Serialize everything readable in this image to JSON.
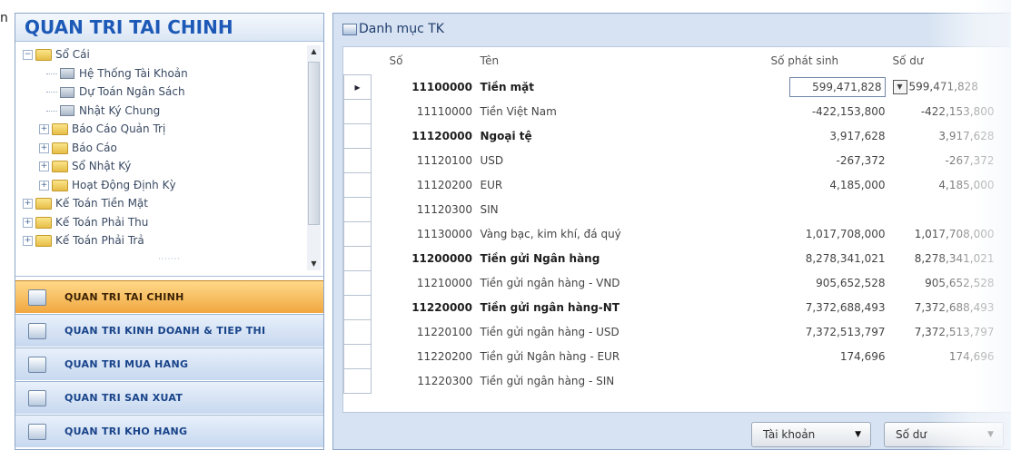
{
  "stray_text": "n",
  "left_panel": {
    "title": "QUAN TRI TAI CHINH",
    "tree": [
      {
        "label": "Sổ Cái",
        "type": "folder",
        "expand": "−"
      },
      {
        "label": "Hệ Thống Tài Khoản",
        "type": "doc"
      },
      {
        "label": "Dự Toán Ngân Sách",
        "type": "doc"
      },
      {
        "label": "Nhật Ký Chung",
        "type": "doc"
      },
      {
        "label": "Báo Cáo Quản Trị",
        "type": "folder",
        "expand": "+"
      },
      {
        "label": "Báo Cáo",
        "type": "folder",
        "expand": "+"
      },
      {
        "label": "Sổ Nhật Ký",
        "type": "folder",
        "expand": "+"
      },
      {
        "label": "Hoạt Động Định Kỳ",
        "type": "folder",
        "expand": "+"
      },
      {
        "label": "Kế Toán Tiền Mặt",
        "type": "folder",
        "expand": "+"
      },
      {
        "label": "Kế Toán Phải Thu",
        "type": "folder",
        "expand": "+"
      },
      {
        "label": "Kế Toán Phải Trả",
        "type": "folder",
        "expand": "+"
      }
    ],
    "grip": "·······",
    "nav": [
      {
        "label": "QUAN TRI TAI CHINH",
        "active": true
      },
      {
        "label": "QUAN TRI KINH DOANH & TIEP THI",
        "active": false
      },
      {
        "label": "QUAN TRI MUA HANG",
        "active": false
      },
      {
        "label": "QUAN TRI SAN XUAT",
        "active": false
      },
      {
        "label": "QUAN TRI KHO HANG",
        "active": false
      }
    ]
  },
  "right_panel": {
    "title": "Danh mục TK",
    "columns": [
      "Số",
      "Tên",
      "Số phát sinh",
      "Số dư"
    ],
    "rows": [
      {
        "code": "11100000",
        "name": "Tiền mặt",
        "phat_sinh": "599,471,828",
        "so_du": "599,471,828",
        "bold": true,
        "selected": true
      },
      {
        "code": "11110000",
        "name": "Tiền Việt Nam",
        "phat_sinh": "-422,153,800",
        "so_du": "-422,153,800",
        "bold": false
      },
      {
        "code": "11120000",
        "name": "Ngoại tệ",
        "phat_sinh": "3,917,628",
        "so_du": "3,917,628",
        "bold": true
      },
      {
        "code": "11120100",
        "name": "USD",
        "phat_sinh": "-267,372",
        "so_du": "-267,372",
        "bold": false
      },
      {
        "code": "11120200",
        "name": "EUR",
        "phat_sinh": "4,185,000",
        "so_du": "4,185,000",
        "bold": false
      },
      {
        "code": "11120300",
        "name": "SIN",
        "phat_sinh": "",
        "so_du": "",
        "bold": false
      },
      {
        "code": "11130000",
        "name": "Vàng bạc, kim khí, đá quý",
        "phat_sinh": "1,017,708,000",
        "so_du": "1,017,708,000",
        "bold": false
      },
      {
        "code": "11200000",
        "name": "Tiền gửi Ngân hàng",
        "phat_sinh": "8,278,341,021",
        "so_du": "8,278,341,021",
        "bold": true
      },
      {
        "code": "11210000",
        "name": "Tiền gửi ngân hàng - VND",
        "phat_sinh": "905,652,528",
        "so_du": "905,652,528",
        "bold": false
      },
      {
        "code": "11220000",
        "name": "Tiền gửi ngân hàng-NT",
        "phat_sinh": "7,372,688,493",
        "so_du": "7,372,688,493",
        "bold": true
      },
      {
        "code": "11220100",
        "name": "Tiền gửi ngân hàng - USD",
        "phat_sinh": "7,372,513,797",
        "so_du": "7,372,513,797",
        "bold": false
      },
      {
        "code": "11220200",
        "name": "Tiền gửi Ngân hàng - EUR",
        "phat_sinh": "174,696",
        "so_du": "174,696",
        "bold": false
      },
      {
        "code": "11220300",
        "name": "Tiền gửi ngân hàng - SIN",
        "phat_sinh": "",
        "so_du": "",
        "bold": false
      }
    ],
    "buttons": {
      "account": "Tài khoản",
      "balance": "Số dư"
    }
  }
}
